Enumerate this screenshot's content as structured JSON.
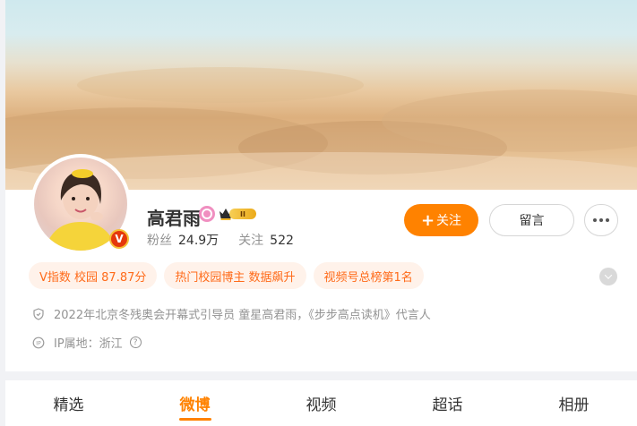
{
  "profile": {
    "name": "高君雨",
    "verified_badge": "V",
    "level": "II",
    "followers_label": "粉丝",
    "followers_value": "24.9万",
    "following_label": "关注",
    "following_value": "522"
  },
  "actions": {
    "follow_label": "关注",
    "follow_plus": "+",
    "message_label": "留言"
  },
  "tags": [
    "V指数 校园 87.87分",
    "热门校园博主 数据飙升",
    "视频号总榜第1名"
  ],
  "info": {
    "bio": "2022年北京冬残奥会开幕式引导员 童星高君雨，《步步高点读机》代言人",
    "ip": "IP属地：浙江",
    "help_glyph": "?"
  },
  "tabs": [
    "精选",
    "微博",
    "视频",
    "超话",
    "相册"
  ],
  "active_tab": "微博",
  "colors": {
    "accent": "#ff8200",
    "tag_text": "#ff6b1a",
    "tag_bg": "#fff2ea",
    "verified": "#e5380b"
  },
  "icons": {
    "shield": "shield-icon",
    "ip": "ip-icon",
    "help": "question-icon",
    "more": "more-dots-icon",
    "chevron": "chevron-down-icon",
    "crown": "crown-icon",
    "pink": "pink-badge-icon"
  }
}
